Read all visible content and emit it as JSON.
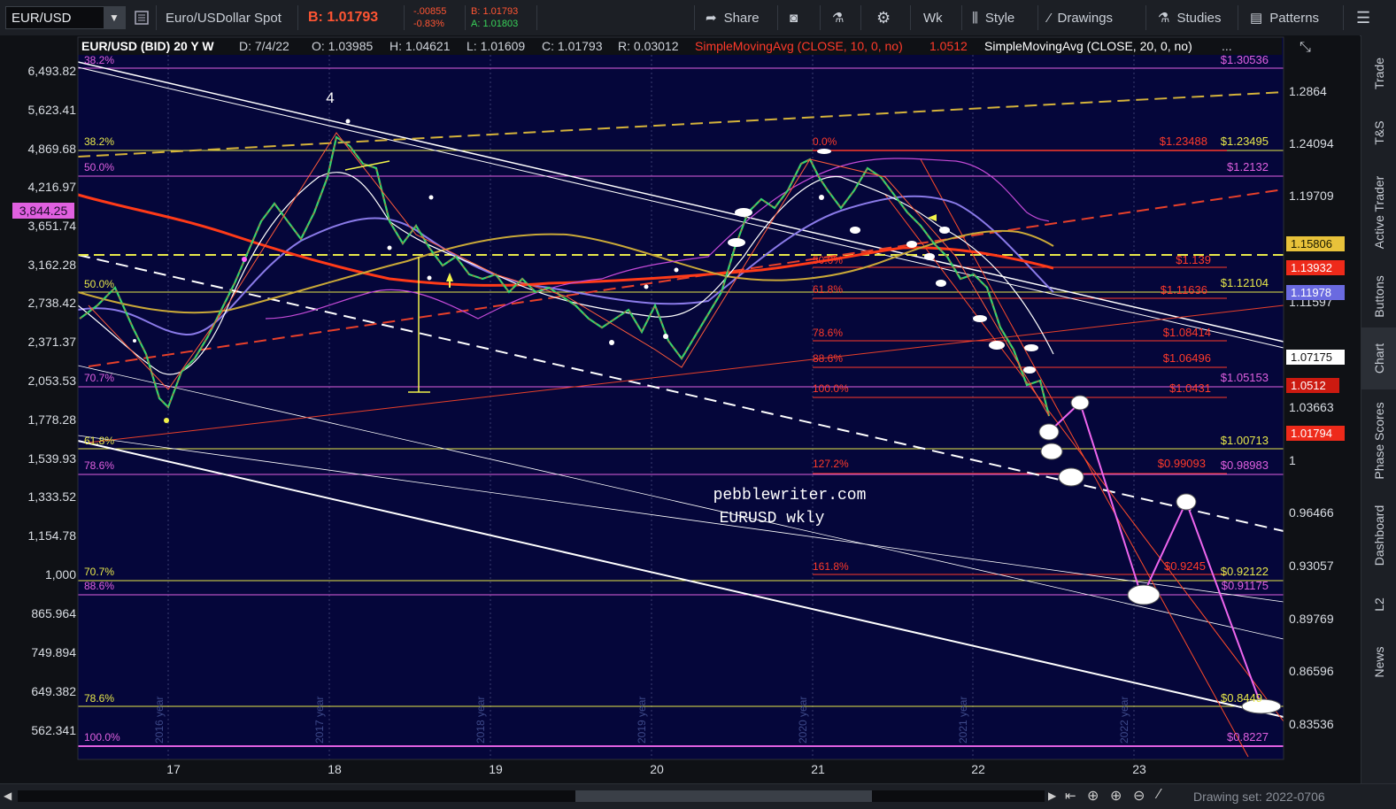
{
  "toolbar": {
    "symbol": "EUR/USD",
    "description": "Euro/USDollar Spot",
    "bid": "B: 1.01793",
    "change": "-.00855",
    "change_pct": "-0.83%",
    "bid_small": "B: 1.01793",
    "ask_small": "A: 1.01803",
    "share": "Share",
    "period": "Wk",
    "style": "Style",
    "drawings": "Drawings",
    "studies": "Studies",
    "patterns": "Patterns"
  },
  "chart_header": {
    "title": "EUR/USD (BID) 20 Y W",
    "date": "D: 7/4/22",
    "open": "O: 1.03985",
    "high": "H: 1.04621",
    "low": "L: 1.01609",
    "close": "C: 1.01793",
    "range": "R: 0.03012",
    "sma10": "SimpleMovingAvg (CLOSE, 10, 0, no)",
    "sma10_value": "1.0512",
    "sma20": "SimpleMovingAvg (CLOSE, 20, 0, no)",
    "more": "..."
  },
  "left_axis": [
    "6,493.82",
    "5,623.41",
    "4,869.68",
    "4,216.97",
    "3,651.74",
    "3,162.28",
    "2,738.42",
    "2,371.37",
    "2,053.53",
    "1,778.28",
    "1,539.93",
    "1,333.52",
    "1,154.78",
    "1,000",
    "865.964",
    "749.894",
    "649.382",
    "562.341"
  ],
  "left_badge": "3,844.25",
  "right_axis": [
    "1.2864",
    "1.24094",
    "1.19709",
    "1.11597",
    "1.03663",
    "1",
    "0.96466",
    "0.93057",
    "0.89769",
    "0.86596",
    "0.83536"
  ],
  "right_badges": {
    "b1": "1.15806",
    "b2": "1.13932",
    "b3": "1.11978",
    "b4": "1.07175",
    "b5": "1.0512",
    "b6": "1.01794"
  },
  "x_labels": [
    "17",
    "18",
    "19",
    "20",
    "21",
    "22",
    "23"
  ],
  "year_labels": [
    "2016 year",
    "2017 year",
    "2018 year",
    "2019 year",
    "2020 year",
    "2021 year",
    "2022 year"
  ],
  "fib_left": {
    "l1": "38.2%",
    "l2": "38.2%",
    "l3": "50.0%",
    "l4": "50.0%",
    "l5": "70.7%",
    "l6": "61.8%",
    "l7": "78.6%",
    "l8": "70.7%",
    "l9": "88.6%",
    "l10": "78.6%",
    "l11": "100.0%"
  },
  "fib_mid": {
    "m1": "0.0%",
    "m2": "50.0%",
    "m3": "61.8%",
    "m4": "78.6%",
    "m5": "88.6%",
    "m6": "100.0%",
    "m7": "127.2%",
    "m8": "161.8%"
  },
  "fib_prices": {
    "p1": "$1.30536",
    "p2": "$1.23488",
    "p3": "$1.23495",
    "p4": "$1.2132",
    "p5": "$1.139",
    "p6": "$1.11636",
    "p7": "$1.12104",
    "p8": "$1.08414",
    "p9": "$1.06496",
    "p10": "$1.0431",
    "p11": "$1.05153",
    "p12": "$1.00713",
    "p13": "$0.99093",
    "p14": "$0.98983",
    "p15": "$0.9245",
    "p16": "$0.92122",
    "p17": "$0.91175",
    "p18": "$0.8449",
    "p19": "$0.8227"
  },
  "wave_label": "4",
  "watermark": {
    "line1": "pebblewriter.com",
    "line2": "EURUSD wkly"
  },
  "right_tabs": [
    "Trade",
    "T&S",
    "Active Trader",
    "Buttons",
    "Chart",
    "Phase Scores",
    "Dashboard",
    "L2",
    "News"
  ],
  "bottom": {
    "drawing_set": "Drawing set: 2022-0706"
  },
  "colors": {
    "bg": "#05063a",
    "yellow": "#f2f24a",
    "magenta": "#e060e0",
    "red": "#ff3a2a",
    "blue": "#7a7ae8",
    "white": "#ffffff",
    "olive": "#c9a838"
  }
}
